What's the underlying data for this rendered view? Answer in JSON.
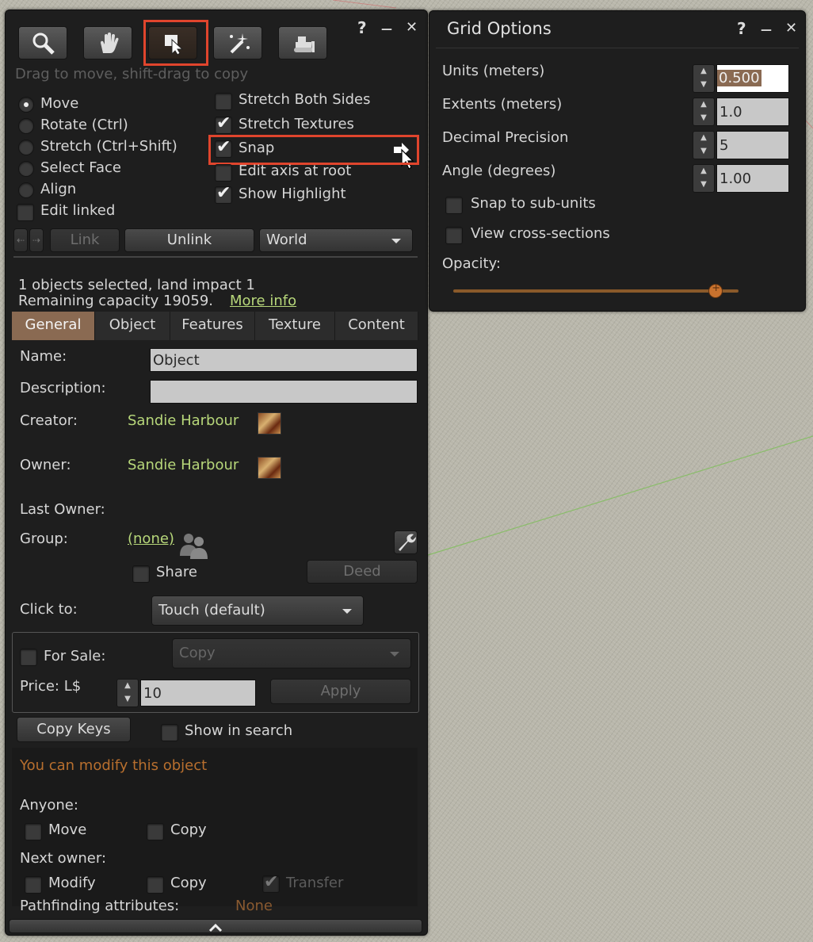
{
  "tools_panel": {
    "title_controls": {
      "help": "?",
      "minimize": "—",
      "close": "✕"
    },
    "toolbar": {
      "tools": [
        "focus-tool",
        "move-tool",
        "edit-tool",
        "create-tool",
        "land-tool"
      ],
      "active": "edit-tool",
      "hint": "Drag to move, shift-drag to copy"
    },
    "modes": {
      "move": "Move",
      "rotate": "Rotate (Ctrl)",
      "stretch": "Stretch (Ctrl+Shift)",
      "select_face": "Select Face",
      "align": "Align",
      "selected": "Move"
    },
    "edit_linked": {
      "label": "Edit linked",
      "checked": false
    },
    "options": {
      "stretch_both": {
        "label": "Stretch Both Sides",
        "checked": false
      },
      "stretch_textures": {
        "label": "Stretch Textures",
        "checked": true
      },
      "snap": {
        "label": "Snap",
        "checked": true
      },
      "edit_axis": {
        "label": "Edit axis at root",
        "checked": false
      },
      "show_highlight": {
        "label": "Show Highlight",
        "checked": true
      }
    },
    "link_row": {
      "link": "Link",
      "unlink": "Unlink",
      "ref_frame": "World"
    },
    "selection": {
      "count_text": "1 objects selected, land impact 1",
      "capacity_text": "Remaining capacity 19059.",
      "more_info": "More info"
    },
    "tabs": [
      "General",
      "Object",
      "Features",
      "Texture",
      "Content"
    ],
    "active_tab": "General",
    "general": {
      "name_label": "Name:",
      "name_value": "Object",
      "description_label": "Description:",
      "description_value": "",
      "creator_label": "Creator:",
      "creator_value": "Sandie Harbour",
      "owner_label": "Owner:",
      "owner_value": "Sandie Harbour",
      "last_owner_label": "Last Owner:",
      "group_label": "Group:",
      "group_value": "(none)",
      "share_label": "Share",
      "deed_label": "Deed",
      "click_to_label": "Click to:",
      "click_to_value": "Touch  (default)",
      "for_sale_label": "For Sale:",
      "sale_type": "Copy",
      "price_label": "Price: L$",
      "price_value": "10",
      "apply_label": "Apply",
      "copy_keys_label": "Copy Keys",
      "show_in_search_label": "Show in search",
      "modify_notice": "You can modify this object",
      "anyone_label": "Anyone:",
      "anyone_move": "Move",
      "anyone_copy": "Copy",
      "next_owner_label": "Next owner:",
      "next_modify": "Modify",
      "next_copy": "Copy",
      "next_transfer": "Transfer",
      "pathfinding_label": "Pathfinding attributes:",
      "pathfinding_value": "None"
    }
  },
  "grid_panel": {
    "title": "Grid Options",
    "title_controls": {
      "help": "?",
      "minimize": "—",
      "close": "✕"
    },
    "units_label": "Units (meters)",
    "units_value": "0.500",
    "extents_label": "Extents (meters)",
    "extents_value": "1.0",
    "precision_label": "Decimal Precision",
    "precision_value": "5",
    "angle_label": "Angle (degrees)",
    "angle_value": "1.00",
    "snap_sub_units": {
      "label": "Snap to sub-units",
      "checked": false
    },
    "cross_sections": {
      "label": "View cross-sections",
      "checked": false
    },
    "opacity_label": "Opacity:",
    "opacity_fraction": 0.92
  },
  "colors": {
    "panel_bg": "#1e1e1e",
    "accent_orange": "#c8722e",
    "link_green": "#b7d77a",
    "highlight_red": "#e0452d",
    "active_tab": "#8a6a52"
  }
}
